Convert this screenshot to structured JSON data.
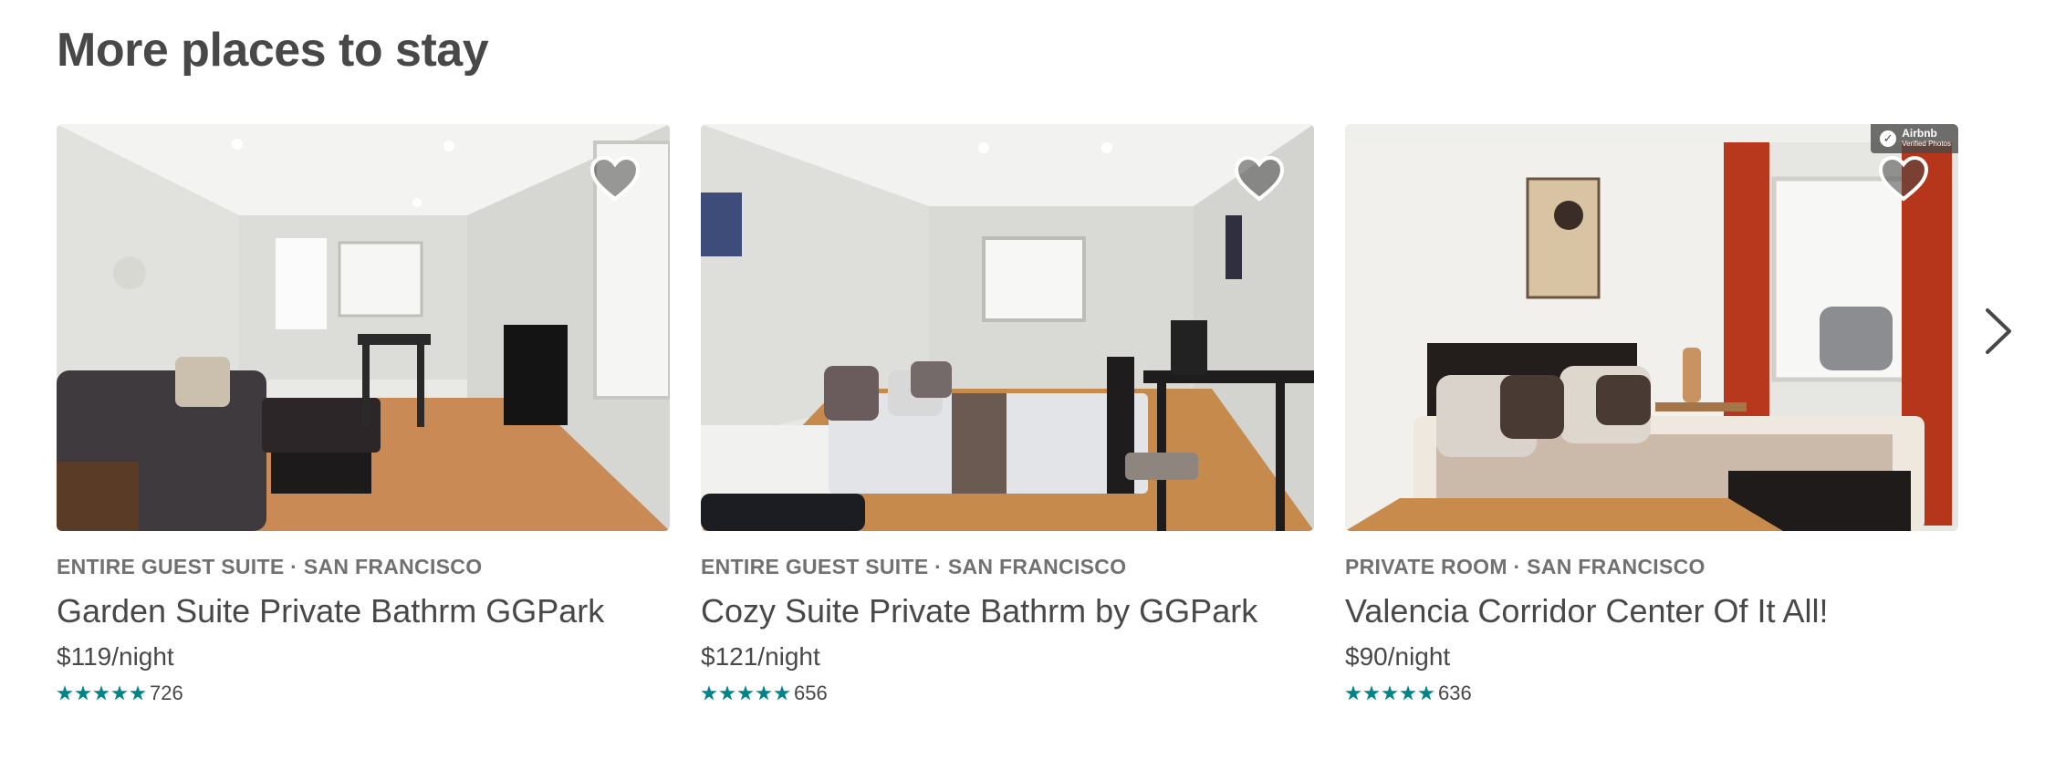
{
  "section": {
    "title": "More places to stay"
  },
  "listings": [
    {
      "kind": "ENTIRE GUEST SUITE · SAN FRANCISCO",
      "title": "Garden Suite Private Bathrm GGPark",
      "price": "$119/night",
      "rating_stars": 5,
      "review_count": "726",
      "saved": false
    },
    {
      "kind": "ENTIRE GUEST SUITE · SAN FRANCISCO",
      "title": "Cozy Suite Private Bathrm by GGPark",
      "price": "$121/night",
      "rating_stars": 5,
      "review_count": "656",
      "saved": false
    },
    {
      "kind": "PRIVATE ROOM · SAN FRANCISCO",
      "title": "Valencia Corridor Center Of It All!",
      "price": "$90/night",
      "rating_stars": 5,
      "review_count": "636",
      "saved": false,
      "badge": {
        "brand": "Airbnb",
        "sub": "Verified Photos"
      }
    }
  ],
  "icons": {
    "heart": "heart-icon",
    "next": "chevron-right-icon",
    "star": "star-icon"
  },
  "colors": {
    "text": "#484848",
    "muted": "#717171",
    "star": "#008489"
  }
}
